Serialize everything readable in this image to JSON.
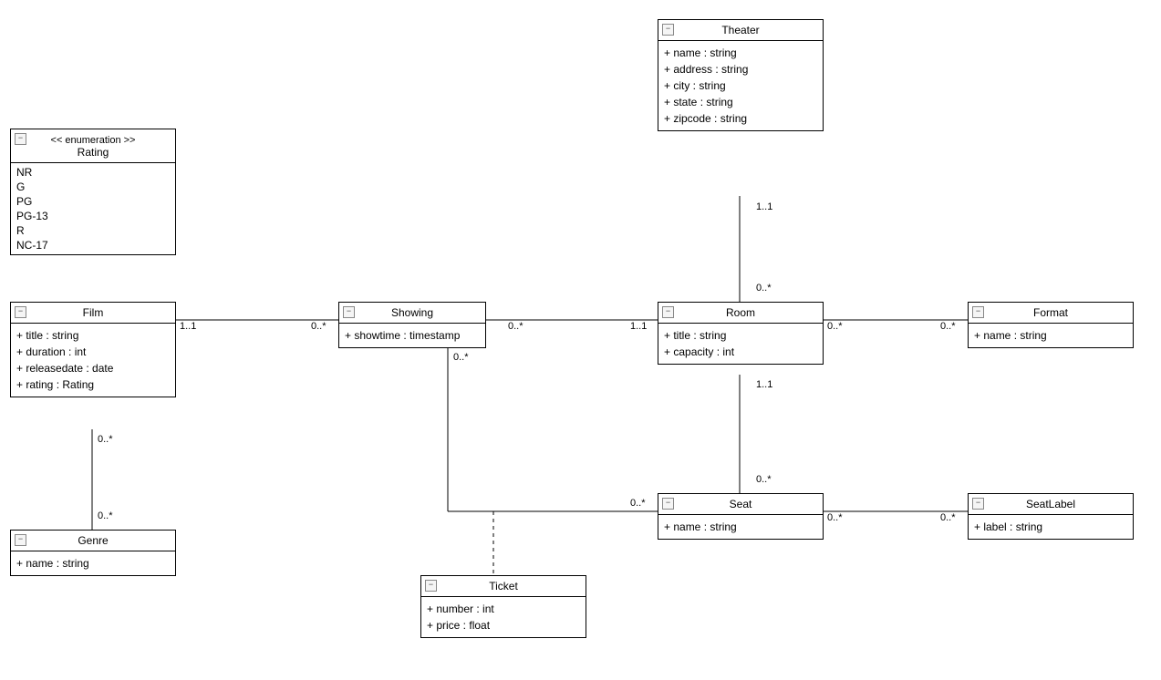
{
  "enumRating": {
    "stereotype": "<< enumeration >>",
    "name": "Rating",
    "values": [
      "NR",
      "G",
      "PG",
      "PG-13",
      "R",
      "NC-17"
    ]
  },
  "film": {
    "name": "Film",
    "attrs": [
      "+ title : string",
      "+ duration : int",
      "+ releasedate : date",
      "+ rating : Rating"
    ]
  },
  "genre": {
    "name": "Genre",
    "attrs": [
      "+ name : string"
    ]
  },
  "showing": {
    "name": "Showing",
    "attrs": [
      "+ showtime : timestamp"
    ]
  },
  "ticket": {
    "name": "Ticket",
    "attrs": [
      "+ number : int",
      "+ price : float"
    ]
  },
  "theater": {
    "name": "Theater",
    "attrs": [
      "+ name : string",
      "+ address : string",
      "+ city : string",
      "+ state : string",
      "+ zipcode : string"
    ]
  },
  "room": {
    "name": "Room",
    "attrs": [
      "+ title : string",
      "+ capacity : int"
    ]
  },
  "format": {
    "name": "Format",
    "attrs": [
      "+ name : string"
    ]
  },
  "seat": {
    "name": "Seat",
    "attrs": [
      "+ name : string"
    ]
  },
  "seatlabel": {
    "name": "SeatLabel",
    "attrs": [
      "+ label : string"
    ]
  },
  "mult": {
    "filmShowing": {
      "a": "1..1",
      "b": "0..*"
    },
    "filmGenre": {
      "a": "0..*",
      "b": "0..*"
    },
    "showingRoom": {
      "a": "0..*",
      "b": "1..1"
    },
    "showingSeat": {
      "a": "0..*",
      "b": "0..*"
    },
    "theaterRoom": {
      "a": "1..1",
      "b": "0..*"
    },
    "roomFormat": {
      "a": "0..*",
      "b": "0..*"
    },
    "roomSeat": {
      "a": "1..1",
      "b": "0..*"
    },
    "seatSeatlabel": {
      "a": "0..*",
      "b": "0..*"
    }
  }
}
